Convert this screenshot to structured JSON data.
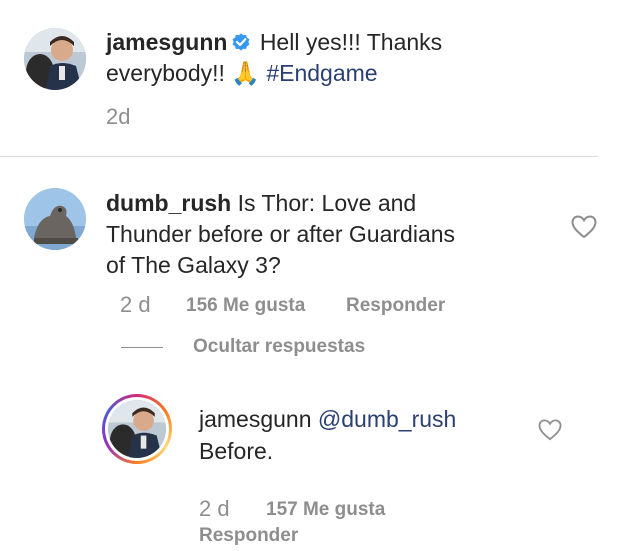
{
  "post": {
    "username": "jamesgunn",
    "text_a": "Hell yes!!! Thanks",
    "text_b": "everybody!!",
    "emoji": "🙏",
    "hashtag": "#Endgame",
    "time": "2d"
  },
  "comment": {
    "username": "dumb_rush",
    "text_line1": "Is Thor: Love and",
    "text_line2": "Thunder before or after Guardians",
    "text_line3": "of The Galaxy 3?",
    "time": "2 d",
    "likes": "156 Me gusta",
    "reply": "Responder",
    "hide_replies": "Ocultar respuestas"
  },
  "reply": {
    "username": "jamesgunn",
    "mention": "@dumb_rush",
    "text": "Before.",
    "time": "2 d",
    "likes": "157 Me gusta",
    "reply": "Responder"
  },
  "colors": {
    "text": "#262626",
    "secondary": "#8e8e8e",
    "link": "#2a3f73",
    "verified": "#3897f0",
    "divider": "#dbdbdb"
  },
  "icons": [
    "verified-badge-icon",
    "heart-icon",
    "folded-hands-emoji"
  ]
}
